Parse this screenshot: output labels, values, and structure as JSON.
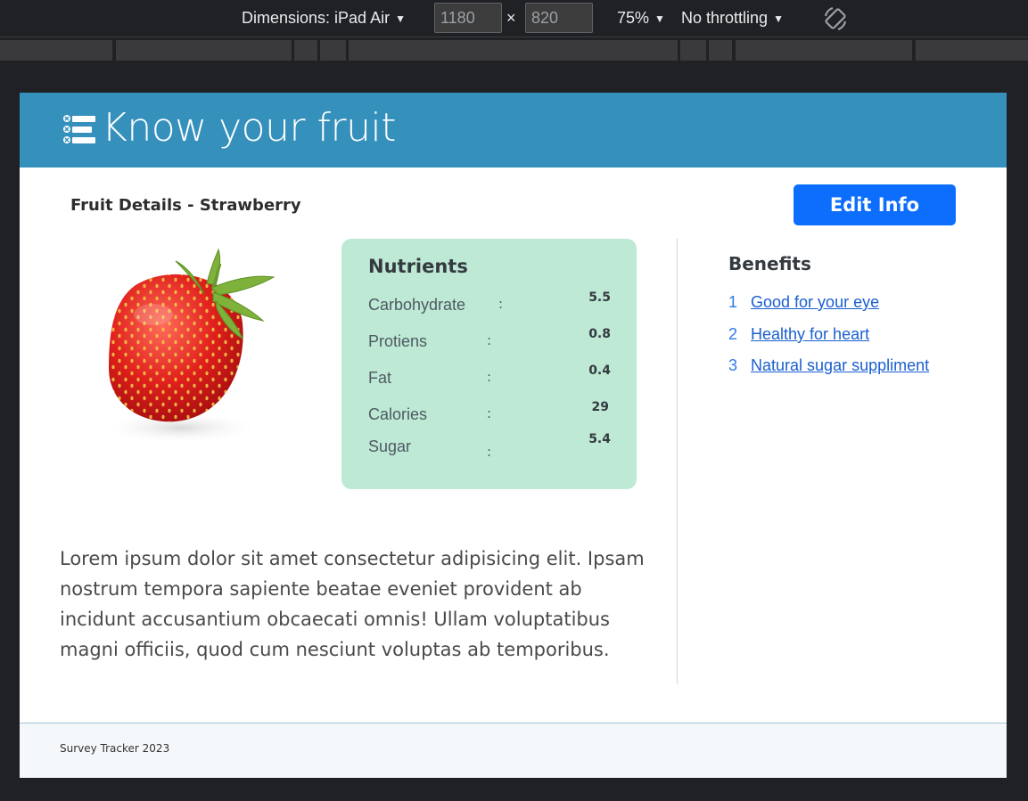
{
  "devtools": {
    "dimensions_label": "Dimensions: iPad Air",
    "width_value": "1180",
    "height_value": "820",
    "times_symbol": "×",
    "zoom": "75%",
    "throttling": "No throttling",
    "icons": {
      "caret": "caret-down-icon",
      "rotate": "rotate-device-icon"
    }
  },
  "app": {
    "title": "Know your fruit",
    "header_color": "#3590bc",
    "logo_icon": "checklist-icon"
  },
  "page": {
    "subheader": "Fruit Details - Strawberry",
    "edit_button": "Edit Info",
    "accent": "#0d6efd",
    "image_alt": "Strawberry"
  },
  "nutrients": {
    "title": "Nutrients",
    "card_color": "#bde9d5",
    "rows": [
      {
        "name": "Carbohydrate",
        "colon": ":",
        "value": "5.5"
      },
      {
        "name": "Protiens",
        "colon": ":",
        "value": "0.8"
      },
      {
        "name": "Fat",
        "colon": ":",
        "value": "0.4"
      },
      {
        "name": "Calories",
        "colon": ":",
        "value": "29"
      },
      {
        "name": "Sugar",
        "colon": ":",
        "value": "5.4"
      }
    ]
  },
  "description": "Lorem ipsum dolor sit amet consectetur adipisicing elit. Ipsam nostrum tempora sapiente beatae eveniet provident ab incidunt accusantium obcaecati omnis! Ullam voluptatibus magni officiis, quod cum nesciunt voluptas ab temporibus.",
  "benefits": {
    "title": "Benefits",
    "items": [
      {
        "num": "1",
        "label": "Good for your eye"
      },
      {
        "num": "2",
        "label": "Healthy for heart"
      },
      {
        "num": "3",
        "label": "Natural sugar suppliment"
      }
    ]
  },
  "footer": {
    "text": "Survey Tracker 2023"
  }
}
